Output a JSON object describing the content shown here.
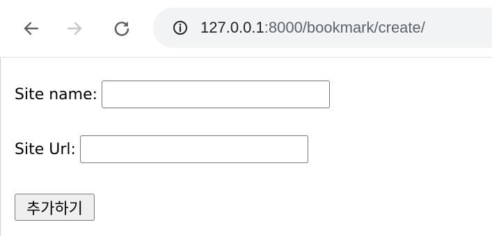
{
  "browser": {
    "url_host": "127.0.0.1",
    "url_rest": ":8000/bookmark/create/",
    "icons": {
      "back": "back-arrow-icon",
      "forward": "forward-arrow-icon",
      "reload": "reload-icon",
      "info": "info-icon"
    },
    "colors": {
      "omnibox_bg": "#f1f3f4",
      "icon_active": "#5f6368",
      "icon_disabled": "#c4c7c5"
    }
  },
  "form": {
    "site_name_label": "Site name:",
    "site_name_value": "",
    "site_url_label": "Site Url:",
    "site_url_value": "",
    "submit_label": "추가하기"
  }
}
